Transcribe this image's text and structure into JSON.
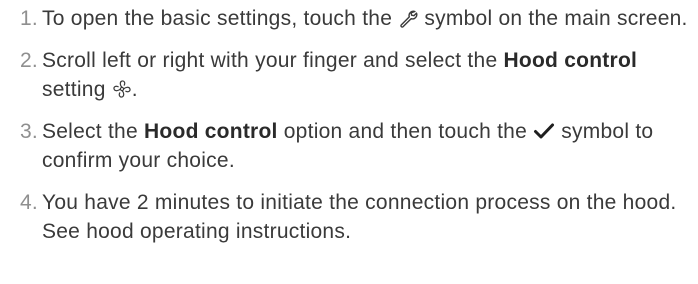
{
  "steps": [
    {
      "number": "1.",
      "text_before": "To open the basic settings, touch the",
      "icon": "wrench-icon",
      "text_after": "symbol on the main screen."
    },
    {
      "number": "2.",
      "text_before": "Scroll left or right with your finger and select the",
      "bold": "Hood control",
      "text_middle": "setting",
      "icon": "fan-icon",
      "text_after": "."
    },
    {
      "number": "3.",
      "text_before": "Select the",
      "bold": "Hood control",
      "text_middle": "option and then touch the",
      "icon": "checkmark-icon",
      "text_after": "symbol to confirm your choice."
    },
    {
      "number": "4.",
      "text_before": "You have 2 minutes to initiate the connection process on the hood. See hood operating instructions."
    }
  ],
  "colors": {
    "text": "#3a3a3a",
    "number": "#8f8f8f",
    "bold": "#2a2a2a"
  }
}
